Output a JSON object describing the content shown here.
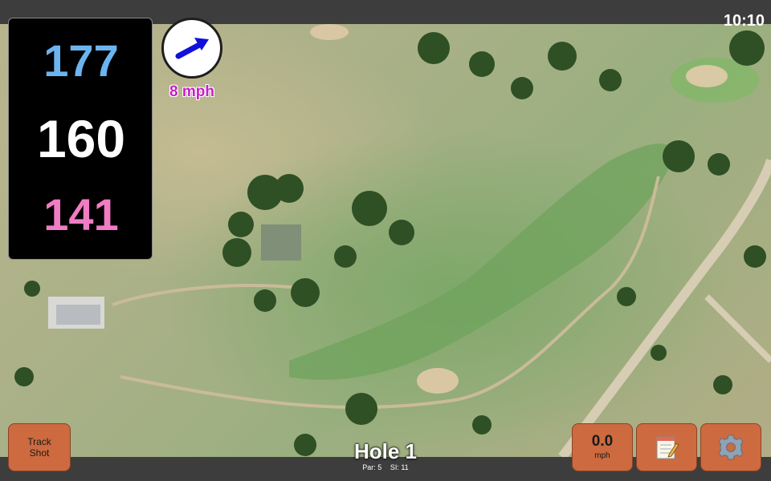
{
  "status_bar": {
    "time": "10:10"
  },
  "distances": {
    "back": {
      "value": "177",
      "color": "#6cb4f0"
    },
    "center": {
      "value": "160",
      "color": "#ffffff"
    },
    "front": {
      "value": "141",
      "color": "#f07cc4"
    }
  },
  "wind": {
    "speed_label": "8 mph",
    "arrow_icon": "wind-direction-arrow-icon",
    "arrow_color": "#1010dd"
  },
  "hole": {
    "title": "Hole 1",
    "par": "Par: 5",
    "stroke_index": "SI: 11"
  },
  "buttons": {
    "track_shot_line1": "Track",
    "track_shot_line2": "Shot",
    "speed_value": "0.0",
    "speed_unit": "mph",
    "notes_icon": "notepad-icon",
    "settings_icon": "gear-icon"
  },
  "colors": {
    "button_fill": "#cd6a3f",
    "bar_background": "#3d3d3d",
    "wind_label": "#c61fc6"
  }
}
